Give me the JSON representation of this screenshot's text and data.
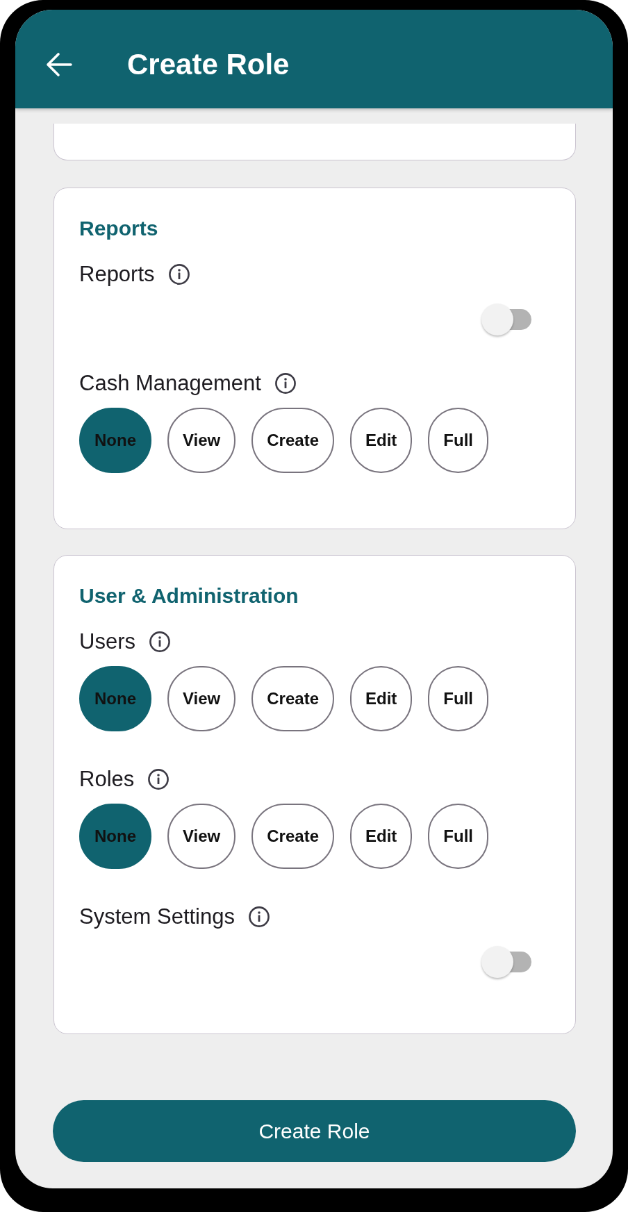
{
  "header": {
    "title": "Create Role"
  },
  "sections": [
    {
      "title": "Reports",
      "permissions": [
        {
          "label": "Reports",
          "kind": "toggle",
          "on": false
        },
        {
          "label": "Cash Management",
          "kind": "levels",
          "options": [
            {
              "label": "None",
              "selected": true
            },
            {
              "label": "View",
              "selected": false
            },
            {
              "label": "Create",
              "selected": false
            },
            {
              "label": "Edit",
              "selected": false
            },
            {
              "label": "Full",
              "selected": false
            }
          ]
        }
      ]
    },
    {
      "title": "User & Administration",
      "permissions": [
        {
          "label": "Users",
          "kind": "levels",
          "options": [
            {
              "label": "None",
              "selected": true
            },
            {
              "label": "View",
              "selected": false
            },
            {
              "label": "Create",
              "selected": false
            },
            {
              "label": "Edit",
              "selected": false
            },
            {
              "label": "Full",
              "selected": false
            }
          ]
        },
        {
          "label": "Roles",
          "kind": "levels",
          "options": [
            {
              "label": "None",
              "selected": true
            },
            {
              "label": "View",
              "selected": false
            },
            {
              "label": "Create",
              "selected": false
            },
            {
              "label": "Edit",
              "selected": false
            },
            {
              "label": "Full",
              "selected": false
            }
          ]
        },
        {
          "label": "System Settings",
          "kind": "toggle",
          "on": false
        }
      ]
    }
  ],
  "submit_button": {
    "label": "Create Role"
  }
}
